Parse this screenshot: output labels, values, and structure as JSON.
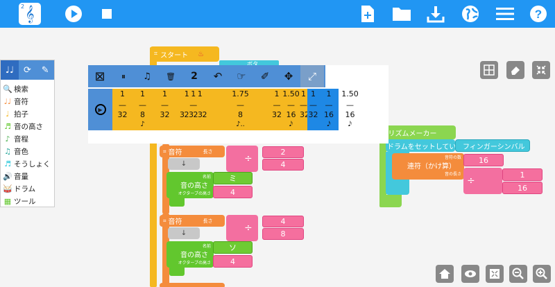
{
  "toolbar": {
    "logo_digit": "2",
    "logo_note": "𝄞",
    "icons": [
      "play-icon",
      "stop-icon",
      "new-file-icon",
      "open-folder-icon",
      "download-icon",
      "globe-icon",
      "menu-icon",
      "help-icon"
    ]
  },
  "categories": {
    "tabs": [
      "♩♩",
      "⟳",
      "✎"
    ],
    "items": [
      {
        "label": "検索",
        "icon": "🔍",
        "color": "#555555"
      },
      {
        "label": "音符",
        "icon": "♩♩",
        "color": "#f48c3c"
      },
      {
        "label": "拍子",
        "icon": "♩",
        "color": "#f5b820"
      },
      {
        "label": "音の高さ",
        "icon": "♬",
        "color": "#62c72e"
      },
      {
        "label": "音程",
        "icon": "♪",
        "color": "#4caf50"
      },
      {
        "label": "音色",
        "icon": "♫",
        "color": "#26a69a"
      },
      {
        "label": "そうしょく",
        "icon": "♬",
        "color": "#26c6da"
      },
      {
        "label": "音量",
        "icon": "🔊",
        "color": "#29b6f6"
      },
      {
        "label": "ドラム",
        "icon": "🥁",
        "color": "#26c6da"
      },
      {
        "label": "ツール",
        "icon": "▦",
        "color": "#62c72e"
      }
    ]
  },
  "blocks": {
    "start": "スタート",
    "start_partial_cyan": "ボタ",
    "note1": {
      "label": "音符",
      "len_label": "長さ",
      "divide": "÷",
      "num": "2",
      "den": "4"
    },
    "arrow": "↓",
    "pitch1": {
      "label": "音の高さ",
      "name_label": "名前",
      "octave_label": "オクターブの高さ",
      "name": "ミ",
      "octave": "4"
    },
    "note2": {
      "label": "音符",
      "len_label": "長さ",
      "divide": "÷",
      "num": "4",
      "den": "8"
    },
    "pitch2": {
      "label": "音の高さ",
      "name_label": "名前",
      "octave_label": "オクターブの高さ",
      "name": "ソ",
      "octave": "4"
    },
    "rhythm_maker": "リズムメーカー",
    "drum_set": "ドラムをセットしてい",
    "drum_name": "フィンガーシンバル",
    "repeat_note": {
      "label": "連符（かけ算）",
      "count_label": "音符の数",
      "len_label": "音の長さ",
      "count": "16",
      "divide": "÷",
      "num": "1",
      "den": "16"
    }
  },
  "sequencer": {
    "buttons": [
      "⊠",
      "⏸",
      "♫",
      "🗑",
      "2",
      "↶",
      "☞",
      "✐",
      "✥",
      "⤢"
    ],
    "zoom_value": "2",
    "cells": [
      {
        "n": "1",
        "d": "32",
        "g": "",
        "color": "#f5b820"
      },
      {
        "n": "1",
        "d": "8",
        "g": "♪",
        "color": "#f5b820"
      },
      {
        "n": "1",
        "d": "32",
        "g": "",
        "color": "#f5b820"
      },
      {
        "n": "1 1 1",
        "d": "323232",
        "g": "",
        "color": "#f5b820"
      },
      {
        "n": "1.75",
        "d": "8",
        "g": "♪..",
        "color": "#f5b820"
      },
      {
        "n": "1",
        "d": "32",
        "g": "",
        "color": "#f5b820"
      },
      {
        "n": "1.50",
        "d": "16",
        "g": "𝅘𝅥𝅯",
        "color": "#f5b820"
      },
      {
        "n": "1",
        "d": "32",
        "g": "",
        "color": "#f5b820"
      },
      {
        "n": "1",
        "d": "32",
        "g": "",
        "color": "#1e88e5"
      },
      {
        "n": "1",
        "d": "16",
        "g": "𝅘𝅥𝅯",
        "color": "#1e88e5"
      },
      {
        "n": "1.50",
        "d": "16",
        "g": "𝅘𝅥𝅯",
        "color": "#ffffff"
      }
    ]
  },
  "controls": {
    "top_right": [
      "grid-icon",
      "eraser-icon",
      "collapse-icon"
    ],
    "bottom_right": [
      "home-icon",
      "eye-icon",
      "fullscreen-icon",
      "zoom-out-icon",
      "zoom-in-icon"
    ]
  }
}
